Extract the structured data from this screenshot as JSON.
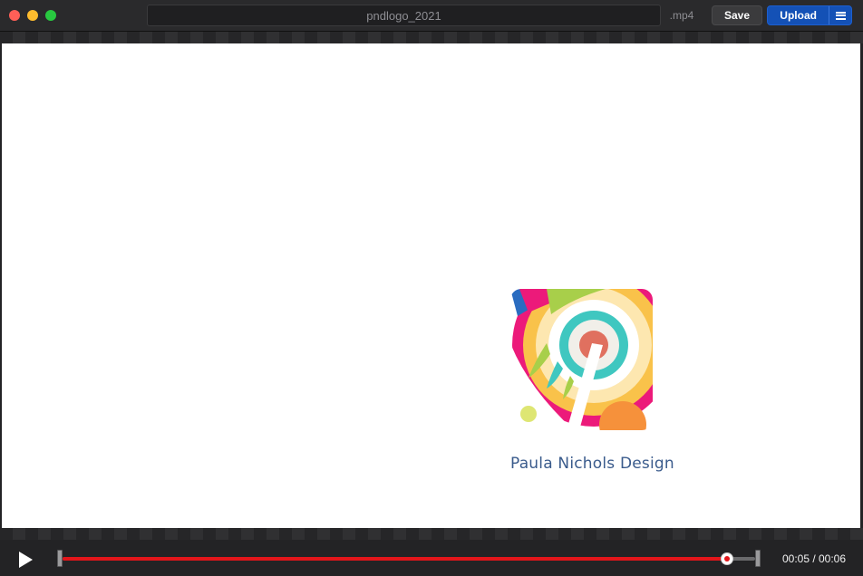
{
  "window": {
    "filename_value": "pndlogo_2021",
    "extension": ".mp4"
  },
  "toolbar": {
    "save_label": "Save",
    "upload_label": "Upload"
  },
  "video": {
    "brand_text": "Paula Nichols Design"
  },
  "playback": {
    "time_display": "00:05 / 00:06",
    "progress_fraction": 0.96
  },
  "colors": {
    "accent": "#e3151a",
    "upload_button": "#1451b6",
    "brand_text": "#3a5b8c"
  },
  "icons": {
    "play": "play-icon",
    "menu": "hamburger-menu-icon"
  }
}
